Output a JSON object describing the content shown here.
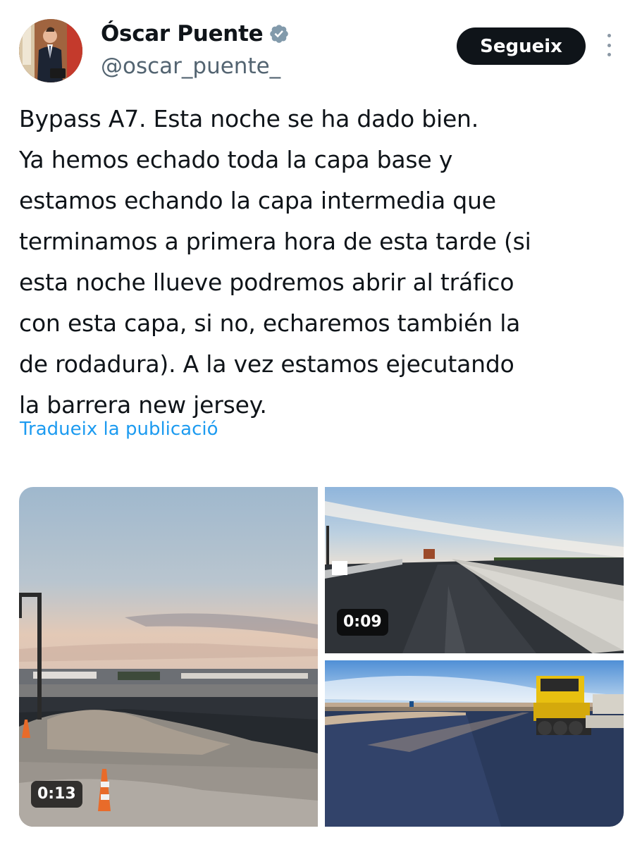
{
  "author": {
    "display_name": "Óscar Puente",
    "handle": "@oscar_puente_",
    "verified_icon": "verified-badge-icon",
    "accent_color": "#829aab"
  },
  "actions": {
    "follow_label": "Segueix",
    "more_icon": "more-vertical-icon"
  },
  "tweet": {
    "text": "Bypass A7. Esta noche se ha dado bien.\nYa hemos echado toda la capa base y\nestamos echando la capa intermedia que\nterminamos a primera hora de esta tarde (si\nesta noche llueve podremos abrir al tráfico\ncon esta capa, si no, echaremos también la\nde rodadura). A la vez estamos ejecutando\nla barrera new jersey.",
    "translate_label": "Tradueix la publicació",
    "link_color": "#1d9bf0"
  },
  "media": [
    {
      "type": "video",
      "duration": "0:13"
    },
    {
      "type": "video",
      "duration": "0:09"
    },
    {
      "type": "image"
    }
  ]
}
